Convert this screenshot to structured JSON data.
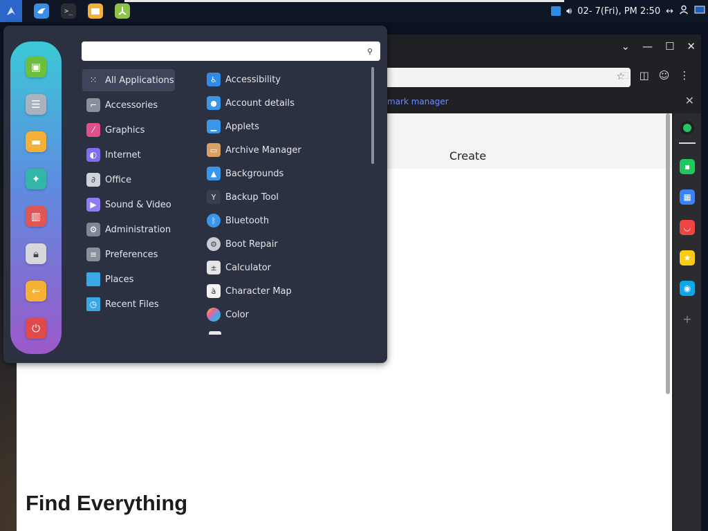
{
  "taskbar": {
    "clock": "02- 7(Fri), PM 2:50",
    "launchers": [
      "bird-app",
      "terminal",
      "files",
      "graphics-app"
    ]
  },
  "browser": {
    "bookmark_link": "mark manager",
    "header_label": "Create",
    "page_title": "Find Everything"
  },
  "menu": {
    "search": {
      "value": "",
      "placeholder": ""
    },
    "categories": [
      {
        "label": "All Applications",
        "icon": "grid-icon",
        "color": "#3e455a"
      },
      {
        "label": "Accessories",
        "icon": "accessories-icon",
        "color": "#8a8f9c"
      },
      {
        "label": "Graphics",
        "icon": "graphics-icon",
        "color": "#e0508a"
      },
      {
        "label": "Internet",
        "icon": "internet-icon",
        "color": "#7d6ff0"
      },
      {
        "label": "Office",
        "icon": "office-icon",
        "color": "#cfd3da"
      },
      {
        "label": "Sound & Video",
        "icon": "play-icon",
        "color": "#8d7cf5"
      },
      {
        "label": "Administration",
        "icon": "admin-icon",
        "color": "#7f8593"
      },
      {
        "label": "Preferences",
        "icon": "preferences-icon",
        "color": "#8a8f9c"
      },
      {
        "label": "Places",
        "icon": "folder-icon",
        "color": "#3aa7e8"
      },
      {
        "label": "Recent Files",
        "icon": "recent-folder-icon",
        "color": "#3aa7e8"
      }
    ],
    "apps": [
      {
        "label": "Accessibility",
        "icon": "accessibility-icon",
        "color": "#2f8be6"
      },
      {
        "label": "Account details",
        "icon": "account-icon",
        "color": "#3a96e8"
      },
      {
        "label": "Applets",
        "icon": "applets-icon",
        "color": "#3a96e8"
      },
      {
        "label": "Archive Manager",
        "icon": "archive-icon",
        "color": "#d9a066"
      },
      {
        "label": "Backgrounds",
        "icon": "backgrounds-icon",
        "color": "#3a96e8"
      },
      {
        "label": "Backup Tool",
        "icon": "backup-icon",
        "color": "#3a3f4c"
      },
      {
        "label": "Bluetooth",
        "icon": "bluetooth-icon",
        "color": "#3a96e8"
      },
      {
        "label": "Boot Repair",
        "icon": "boot-repair-icon",
        "color": "#c9ccd4"
      },
      {
        "label": "Calculator",
        "icon": "calculator-icon",
        "color": "#e6e6e6"
      },
      {
        "label": "Character Map",
        "icon": "character-map-icon",
        "color": "#f2f2f2"
      },
      {
        "label": "Color",
        "icon": "color-icon",
        "color": "#f06292"
      }
    ],
    "favorites": [
      {
        "icon": "software-icon",
        "color": "#6cbf3c"
      },
      {
        "icon": "settings-icon",
        "color": "#aab2bf"
      },
      {
        "icon": "files-icon",
        "color": "#f2b23a"
      },
      {
        "icon": "app-icon",
        "color": "#31b6a8"
      },
      {
        "icon": "dictionary-icon",
        "color": "#e25555"
      },
      {
        "icon": "lock-icon",
        "color": "#d5d7dd"
      },
      {
        "icon": "logout-icon",
        "color": "#f5b236"
      },
      {
        "icon": "power-icon",
        "color": "#e04a4a"
      }
    ]
  }
}
